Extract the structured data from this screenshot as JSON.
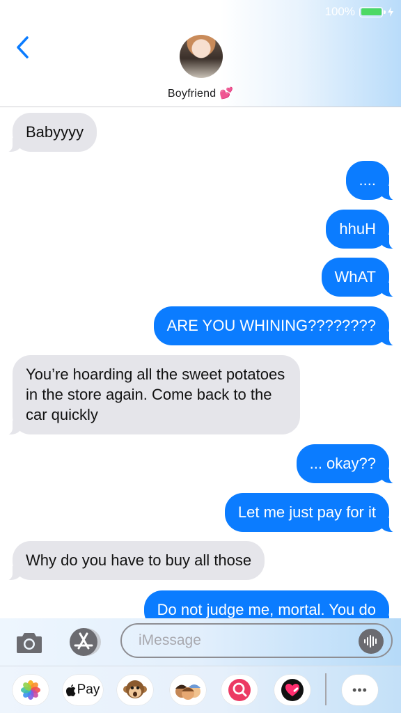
{
  "status_bar": {
    "battery_text": "100%"
  },
  "header": {
    "contact_name": "Boyfriend 💕"
  },
  "messages": [
    {
      "from": "contact",
      "text": "Babyyyy"
    },
    {
      "from": "me",
      "text": "...."
    },
    {
      "from": "me",
      "text": "hhuH"
    },
    {
      "from": "me",
      "text": "WhAT"
    },
    {
      "from": "me",
      "text": "ARE YOU WHINING????????"
    },
    {
      "from": "contact",
      "text": "You’re hoarding all the sweet potatoes in the store again. Come back to the car quickly"
    },
    {
      "from": "me",
      "text": "... okay??"
    },
    {
      "from": "me",
      "text": "Let me just pay for it"
    },
    {
      "from": "contact",
      "text": "Why do you have to buy all those"
    },
    {
      "from": "me",
      "text": "Do not judge me, mortal. You do"
    }
  ],
  "composer": {
    "placeholder": "iMessage",
    "value": ""
  },
  "app_drawer": {
    "apps": [
      "photos-icon",
      "apple-pay",
      "animoji-monkey-icon",
      "memoji-icon",
      "search-images-icon",
      "digital-touch-icon",
      "more-icon"
    ],
    "apple_pay_label": "Pay",
    "more_label": "•••"
  },
  "colors": {
    "outgoing": "#0b7cff",
    "incoming": "#e5e5ea",
    "accent": "#0b7cff"
  }
}
